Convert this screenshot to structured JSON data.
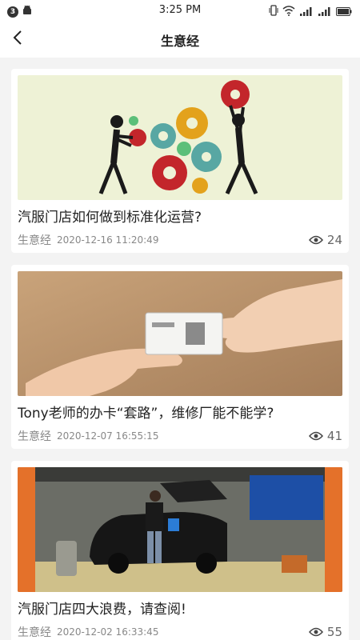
{
  "status_bar": {
    "notification_count": "3",
    "time": "3:25 PM"
  },
  "nav": {
    "title": "生意经"
  },
  "articles": [
    {
      "title": "汽服门店如何做到标准化运营?",
      "source": "生意经",
      "date": "2020-12-16 11:20:49",
      "views": "24",
      "image_icon": "gears-teamwork-illustration"
    },
    {
      "title": "Tony老师的办卡“套路”，维修厂能不能学?",
      "source": "生意经",
      "date": "2020-12-07 16:55:15",
      "views": "41",
      "image_icon": "membership-card-handover-photo"
    },
    {
      "title": "汽服门店四大浪费，请查阅!",
      "source": "生意经",
      "date": "2020-12-02 16:33:45",
      "views": "55",
      "image_icon": "car-wash-shop-photo"
    }
  ]
}
